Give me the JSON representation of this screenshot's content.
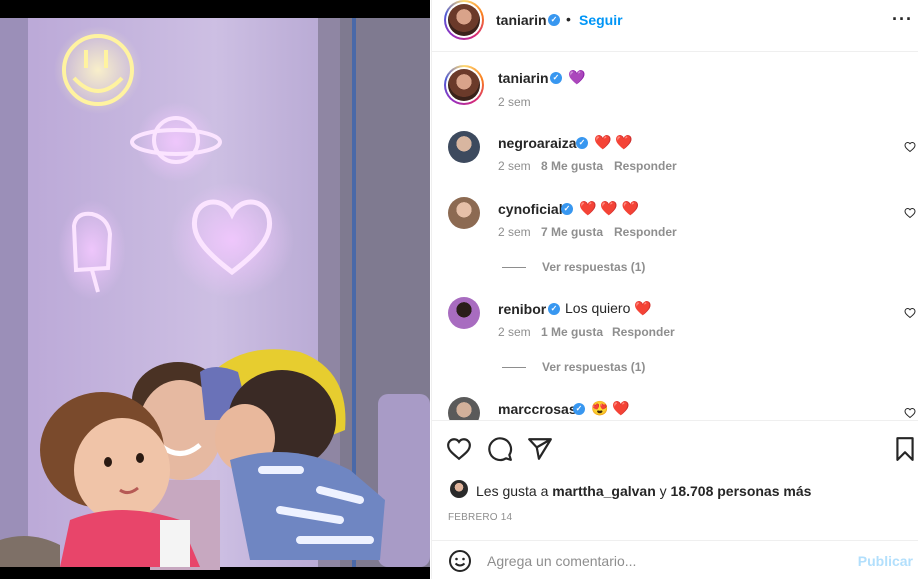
{
  "post": {
    "author": "taniarin",
    "follow_label": "Seguir",
    "more_icon": "more-options-icon",
    "dot": "•"
  },
  "caption": {
    "author": "taniarin",
    "emoji": "💜",
    "time": "2 sem"
  },
  "comments": [
    {
      "user": "negroaraiza",
      "text": "❤️ ❤️",
      "time": "2 sem",
      "likes": "8 Me gusta",
      "reply": "Responder",
      "view_replies": ""
    },
    {
      "user": "cynoficial",
      "text": "❤️ ❤️ ❤️",
      "time": "2 sem",
      "likes": "7 Me gusta",
      "reply": "Responder",
      "view_replies": "Ver respuestas (1)"
    },
    {
      "user": "renibor",
      "text": "Los quiero ❤️",
      "time": "2 sem",
      "likes": "1 Me gusta",
      "reply": "Responder",
      "view_replies": "Ver respuestas (1)"
    },
    {
      "user": "marccrosas",
      "text": "😍 ❤️",
      "time": "",
      "likes": "",
      "reply": "",
      "view_replies": ""
    }
  ],
  "actions": {
    "liked_by_prefix": "Les gusta a",
    "liked_by_user": "marttha_galvan",
    "liked_by_suffix": "y",
    "likes_count": "18.708 personas más",
    "date": "FEBRERO 14"
  },
  "composer": {
    "placeholder": "Agrega un comentario...",
    "publish_label": "Publicar"
  },
  "colors": {
    "accent": "#0095f6",
    "verified": "#3897f0",
    "muted": "#8e8e8e",
    "publish_disabled": "#b2dffc"
  }
}
